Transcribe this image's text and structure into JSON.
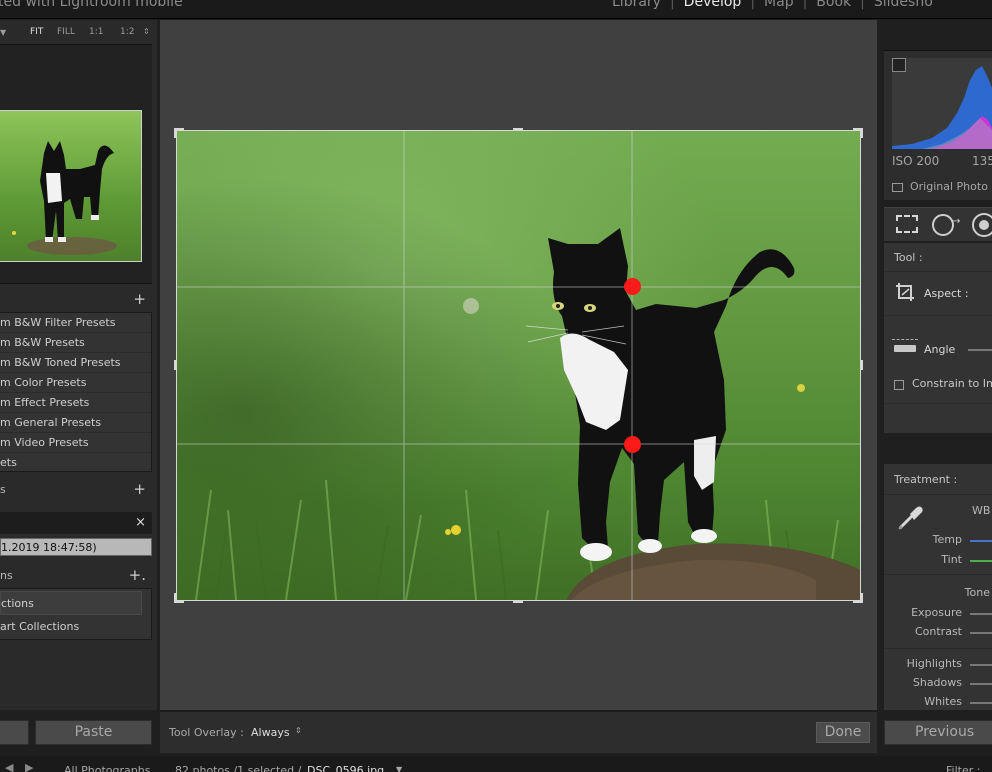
{
  "identity_plate": "ted with Lightroom mobile",
  "modules": [
    {
      "label": "Library",
      "active": false
    },
    {
      "label": "Develop",
      "active": true
    },
    {
      "label": "Map",
      "active": false
    },
    {
      "label": "Book",
      "active": false
    },
    {
      "label": "Slidesho",
      "active": false
    }
  ],
  "navigator": {
    "zoom_options": [
      "FIT",
      "FILL",
      "1:1",
      "1:2"
    ],
    "collapse_glyph": "▼",
    "zoom_caret": "⇕"
  },
  "presets": {
    "add_glyph": "+",
    "items": [
      "m B&W Filter Presets",
      "m B&W Presets",
      "m B&W Toned Presets",
      "m Color Presets",
      "m Effect Presets",
      "m General Presets",
      "m Video Presets",
      "ets"
    ]
  },
  "snapshots": {
    "title": "s",
    "add_glyph": "+"
  },
  "history": {
    "close_glyph": "×",
    "item": "1.2019 18:47:58)"
  },
  "collections": {
    "title": "ns",
    "add_glyph": "+.",
    "items": [
      "ctions",
      "art Collections"
    ]
  },
  "left_buttons": {
    "copy": "",
    "paste": "Paste"
  },
  "toolbar": {
    "overlay_label": "Tool Overlay :",
    "overlay_value": "Always",
    "overlay_caret": "⇕",
    "done_label": "Done"
  },
  "histogram": {
    "iso": "ISO 200",
    "focal": "135",
    "original_label": "Original Photo"
  },
  "crop_panel": {
    "tool_label": "Tool :",
    "aspect_label": "Aspect :",
    "angle_label": "Angle",
    "constrain_label": "Constrain to Im"
  },
  "basic_panel": {
    "treatment_label": "Treatment :",
    "wb_label": "WB",
    "temp_label": "Temp",
    "tint_label": "Tint",
    "tone_label": "Tone",
    "exposure_label": "Exposure",
    "contrast_label": "Contrast",
    "highlights_label": "Highlights",
    "shadows_label": "Shadows",
    "whites_label": "Whites"
  },
  "previous_button": "Previous",
  "filmstrip": {
    "nav_arrows": "◀ ▶",
    "source": "All Photographs",
    "count": "82 photos /1 selected /",
    "filename": "DSC_0596.jpg",
    "filename_caret": "▼",
    "filter_label": "Filter :"
  },
  "colors": {
    "accent_red_handle": "#ff1a1a",
    "panel_bg": "#333333",
    "workspace_bg": "#404040"
  }
}
